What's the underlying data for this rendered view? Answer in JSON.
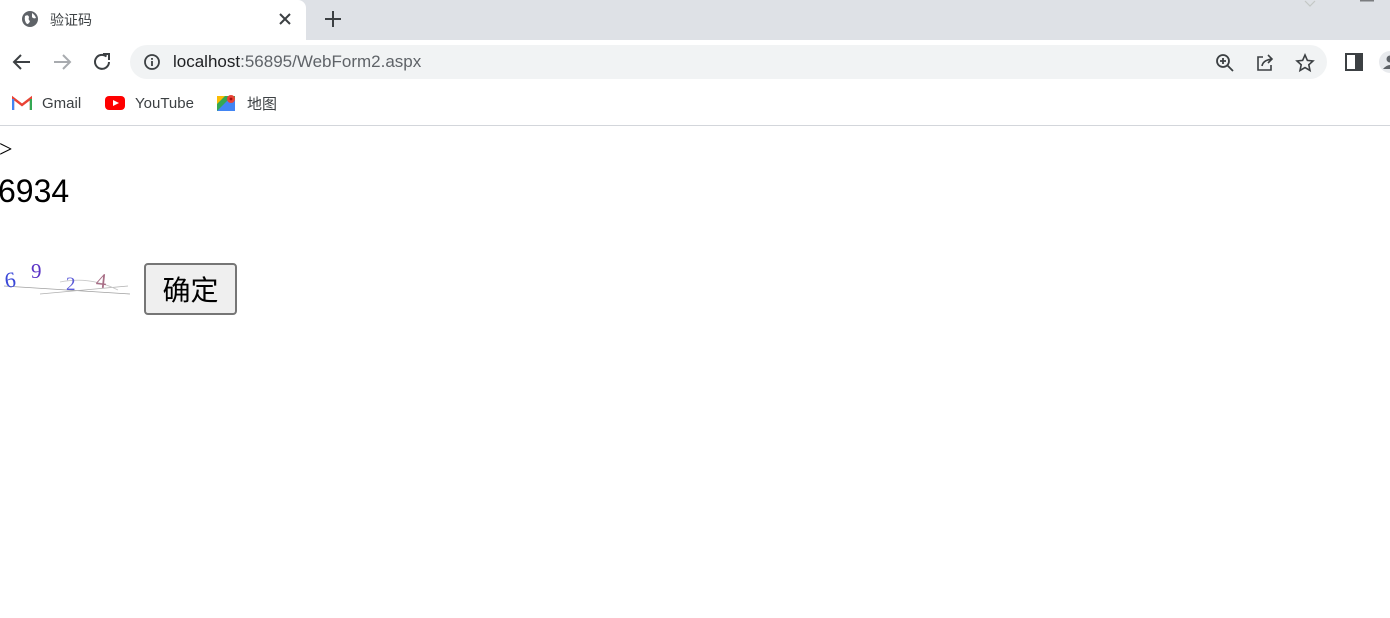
{
  "tab": {
    "title": "验证码",
    "favicon": "globe-icon",
    "close": "close-icon"
  },
  "toolbar": {
    "url_host": "localhost",
    "url_rest": ":56895/WebForm2.aspx",
    "icons": [
      "back-arrow-icon",
      "forward-arrow-icon",
      "reload-icon",
      "info-icon",
      "zoom-icon",
      "share-icon",
      "star-icon",
      "side-panel-icon",
      "profile-icon"
    ]
  },
  "bookmarks": [
    {
      "label": "Gmail",
      "icon": "gmail-icon"
    },
    {
      "label": "YouTube",
      "icon": "youtube-icon"
    },
    {
      "label": "地图",
      "icon": "maps-icon"
    }
  ],
  "page": {
    "stray_text": ">",
    "code_text": "6934",
    "captcha_chars": [
      "6",
      "9",
      "2",
      "4"
    ],
    "button_label": "确定"
  },
  "colors": {
    "tab_strip": "#dee1e6",
    "omnibox": "#f1f3f4",
    "youtube_red": "#ff0000",
    "gmail_red": "#ea4335"
  }
}
